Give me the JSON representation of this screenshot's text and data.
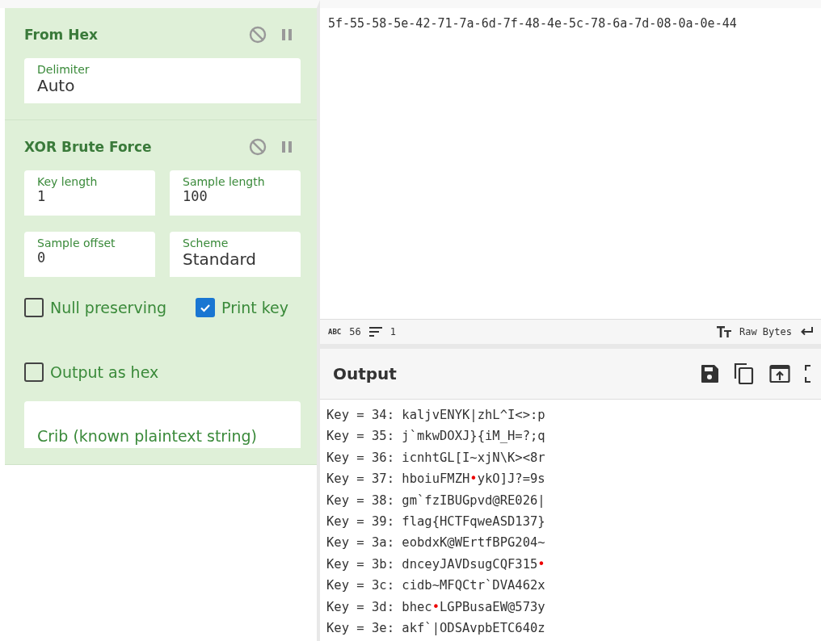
{
  "recipe": [
    {
      "title": "From Hex",
      "fields": [
        {
          "label": "Delimiter",
          "value": "Auto",
          "kind": "select"
        }
      ]
    },
    {
      "title": "XOR Brute Force",
      "fields": [
        {
          "label": "Key length",
          "value": "1",
          "kind": "number"
        },
        {
          "label": "Sample length",
          "value": "100",
          "kind": "number"
        },
        {
          "label": "Sample offset",
          "value": "0",
          "kind": "number"
        },
        {
          "label": "Scheme",
          "value": "Standard",
          "kind": "select"
        }
      ],
      "checkboxes": [
        {
          "label": "Null preserving",
          "checked": false
        },
        {
          "label": "Print key",
          "checked": true
        },
        {
          "label": "Output as hex",
          "checked": false
        }
      ],
      "crib": {
        "placeholder": "Crib (known plaintext string)"
      }
    }
  ],
  "input": {
    "value": "5f-55-58-5e-42-71-7a-6d-7f-48-4e-5c-78-6a-7d-08-0a-0e-44",
    "status": {
      "length_label": "ABC",
      "length": "56",
      "lines": "1",
      "encoding": "Raw Bytes"
    }
  },
  "output": {
    "title": "Output",
    "lines": [
      [
        {
          "kind": "text",
          "text": "Key = 34: kaljvENYK|zhL^I<>:p"
        }
      ],
      [
        {
          "kind": "text",
          "text": "Key = 35: j`mkwDOXJ}{iM_H=?;q"
        }
      ],
      [
        {
          "kind": "text",
          "text": "Key = 36: icnhtGL[I~xjN\\K><8r"
        }
      ],
      [
        {
          "kind": "text",
          "text": "Key = 37: hboiuFMZH"
        },
        {
          "kind": "control",
          "text": "•"
        },
        {
          "kind": "text",
          "text": "ykO]J?=9s"
        }
      ],
      [
        {
          "kind": "text",
          "text": "Key = 38: gm`fzIBUGpvd@RE026|"
        }
      ],
      [
        {
          "kind": "text",
          "text": "Key = 39: flag{HCTFqweASD137}"
        }
      ],
      [
        {
          "kind": "text",
          "text": "Key = 3a: eobdxK@WErtfBPG204~"
        }
      ],
      [
        {
          "kind": "text",
          "text": "Key = 3b: dnceyJAVDsugCQF315"
        },
        {
          "kind": "control",
          "text": "•"
        }
      ],
      [
        {
          "kind": "text",
          "text": "Key = 3c: cidb~MFQCtr`DVA462x"
        }
      ],
      [
        {
          "kind": "text",
          "text": "Key = 3d: bhec"
        },
        {
          "kind": "control",
          "text": "•"
        },
        {
          "kind": "text",
          "text": "LGPBusaEW@573y"
        }
      ],
      [
        {
          "kind": "text",
          "text": "Key = 3e: akf`|ODSAvpbETC640z"
        }
      ]
    ]
  }
}
